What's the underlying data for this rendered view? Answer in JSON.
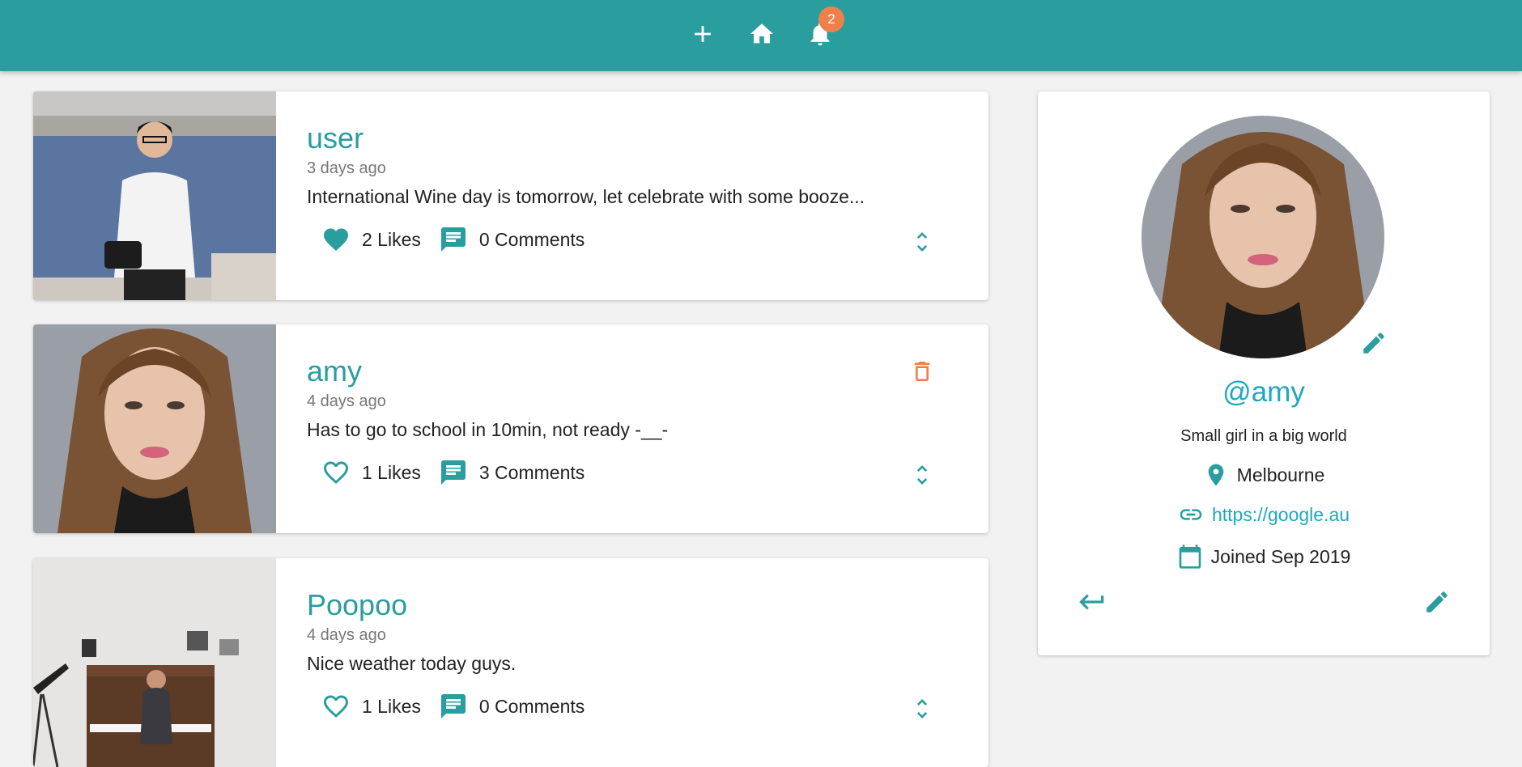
{
  "navbar": {
    "icons": [
      "add-icon",
      "home-icon",
      "notifications-icon"
    ],
    "notification_count": "2",
    "color": "#2a9d9f",
    "badge_color": "#f0804b"
  },
  "posts": [
    {
      "author": "user",
      "time": "3 days ago",
      "body": "International Wine day is tomorrow, let celebrate with some booze...",
      "likes_label": "2 Likes",
      "comments_label": "0 Comments",
      "liked": true,
      "deletable": false,
      "image": "man-with-camera-photo"
    },
    {
      "author": "amy",
      "time": "4 days ago",
      "body": "Has to go to school in 10min, not ready -__-",
      "likes_label": "1 Likes",
      "comments_label": "3 Comments",
      "liked": false,
      "deletable": true,
      "image": "woman-portrait-photo"
    },
    {
      "author": "Poopoo",
      "time": "4 days ago",
      "body": "Nice weather today guys.",
      "likes_label": "1 Likes",
      "comments_label": "0 Comments",
      "liked": false,
      "deletable": false,
      "image": "woman-at-piano-photo"
    }
  ],
  "profile": {
    "handle": "@amy",
    "bio": "Small girl in a big world",
    "location": "Melbourne",
    "website": "https://google.au",
    "joined": "Joined Sep 2019",
    "accent": "#2a9d9f",
    "link_color": "#1ea8bd"
  }
}
